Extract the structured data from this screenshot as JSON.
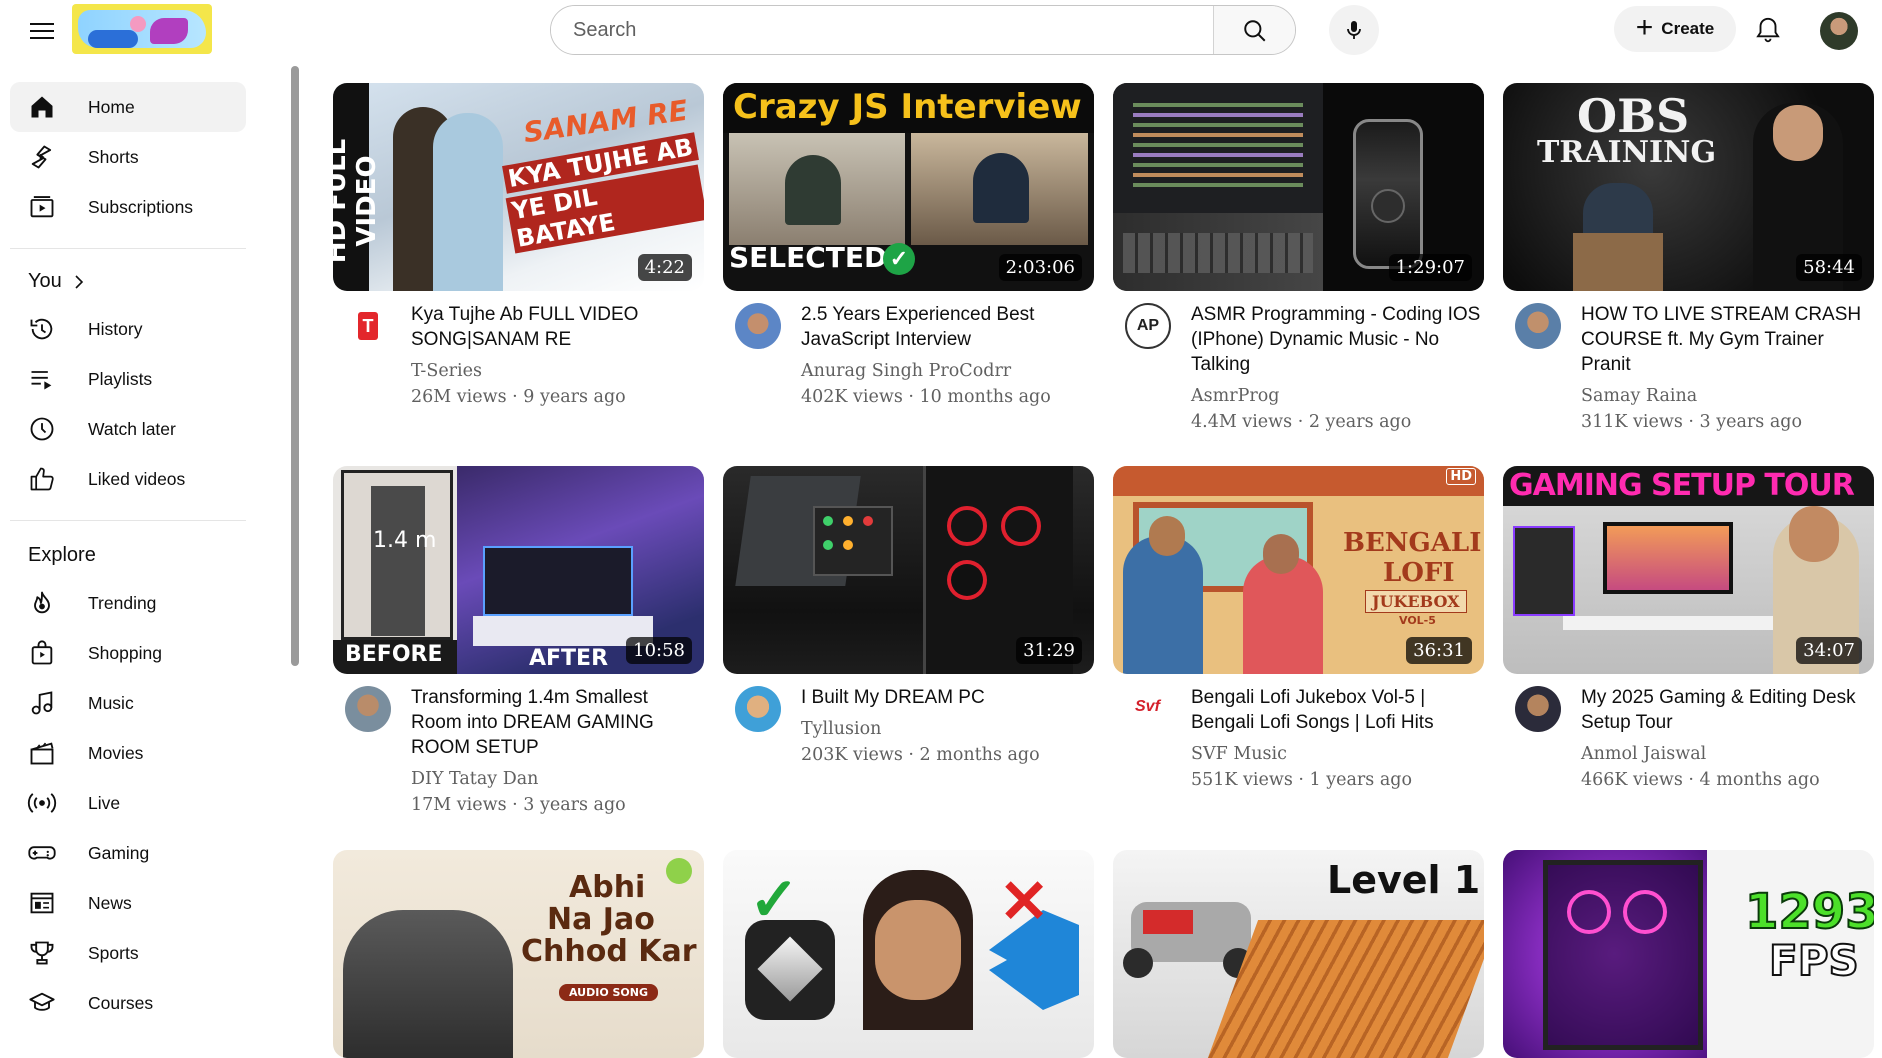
{
  "header": {
    "search_placeholder": "Search",
    "create_label": "Create",
    "icons": [
      "menu-icon",
      "search-icon",
      "mic-icon",
      "plus-icon",
      "bell-icon"
    ]
  },
  "sidebar": {
    "main": [
      {
        "label": "Home",
        "icon": "home-icon"
      },
      {
        "label": "Shorts",
        "icon": "shorts-icon"
      },
      {
        "label": "Subscriptions",
        "icon": "subscriptions-icon"
      }
    ],
    "you_heading": "You",
    "you": [
      {
        "label": "History",
        "icon": "history-icon"
      },
      {
        "label": "Playlists",
        "icon": "playlists-icon"
      },
      {
        "label": "Watch later",
        "icon": "watch-later-icon"
      },
      {
        "label": "Liked videos",
        "icon": "like-icon"
      }
    ],
    "explore_heading": "Explore",
    "explore": [
      {
        "label": "Trending",
        "icon": "trending-icon"
      },
      {
        "label": "Shopping",
        "icon": "shopping-icon"
      },
      {
        "label": "Music",
        "icon": "music-icon"
      },
      {
        "label": "Movies",
        "icon": "movies-icon"
      },
      {
        "label": "Live",
        "icon": "live-icon"
      },
      {
        "label": "Gaming",
        "icon": "gaming-icon"
      },
      {
        "label": "News",
        "icon": "news-icon"
      },
      {
        "label": "Sports",
        "icon": "sports-icon"
      },
      {
        "label": "Courses",
        "icon": "courses-icon"
      }
    ]
  },
  "videos": [
    {
      "title": "Kya Tujhe Ab FULL VIDEO SONG|SANAM RE",
      "channel": "T-Series",
      "views": "26M views",
      "age": "9 years ago",
      "duration": "4:22",
      "thumb_text": [
        "HD FULL VIDEO",
        "SANAM RE",
        "KYA TUJHE AB",
        "YE DIL BATAYE"
      ]
    },
    {
      "title": "2.5 Years Experienced Best JavaScript Interview",
      "channel": "Anurag Singh ProCodrr",
      "views": "402K views",
      "age": "10 months ago",
      "duration": "2:03:06",
      "thumb_text": [
        "Crazy",
        "JS Interview",
        "SELECTED"
      ]
    },
    {
      "title": "ASMR Programming - Coding IOS (IPhone) Dynamic Music - No Talking",
      "channel": "AsmrProg",
      "views": "4.4M views",
      "age": "2 years ago",
      "duration": "1:29:07",
      "thumb_text": []
    },
    {
      "title": "HOW TO LIVE STREAM CRASH COURSE ft. My Gym Trainer Pranit",
      "channel": "Samay Raina",
      "views": "311K views",
      "age": "3 years ago",
      "duration": "58:44",
      "thumb_text": [
        "OBS",
        "TRAINING"
      ]
    },
    {
      "title": "Transforming 1.4m Smallest Room into DREAM GAMING ROOM SETUP",
      "channel": "DIY Tatay Dan",
      "views": "17M views",
      "age": "3 years ago",
      "duration": "10:58",
      "thumb_text": [
        "1.4 m",
        "BEFORE",
        "AFTER"
      ]
    },
    {
      "title": "I Built My DREAM PC",
      "channel": "Tyllusion",
      "views": "203K views",
      "age": "2 months ago",
      "duration": "31:29",
      "thumb_text": []
    },
    {
      "title": "Bengali Lofi Jukebox Vol-5 | Bengali Lofi Songs | Lofi Hits",
      "channel": "SVF Music",
      "views": "551K views",
      "age": "1 years ago",
      "duration": "36:31",
      "thumb_text": [
        "BENGALI",
        "LOFI",
        "JUKEBOX",
        "VOL-5",
        "HD"
      ]
    },
    {
      "title": "My 2025 Gaming & Editing Desk Setup Tour",
      "channel": "Anmol Jaiswal",
      "views": "466K views",
      "age": "4 months ago",
      "duration": "34:07",
      "thumb_text": [
        "GAMING SETUP TOUR"
      ]
    },
    {
      "thumb_text": [
        "Abhi",
        "Na Jao",
        "Chhod Kar",
        "AUDIO SONG"
      ]
    },
    {
      "thumb_text": []
    },
    {
      "thumb_text": [
        "Level 1"
      ]
    },
    {
      "thumb_text": [
        "1293",
        "FPS"
      ]
    }
  ]
}
